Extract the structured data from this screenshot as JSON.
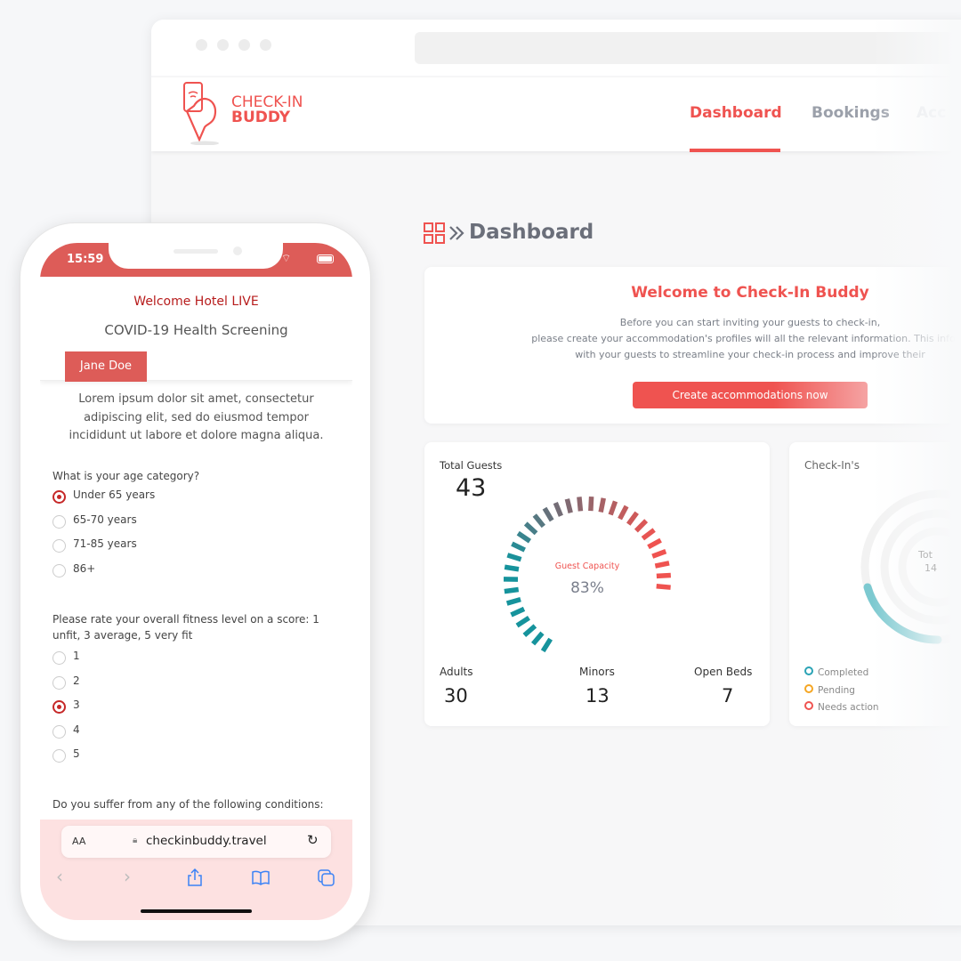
{
  "browser": {
    "nav": {
      "items": [
        {
          "label": "Dashboard",
          "active": true
        },
        {
          "label": "Bookings"
        },
        {
          "label": "Acc"
        }
      ]
    },
    "logo": {
      "line1": "CHECK-IN",
      "line2": "BUDDY"
    },
    "page_title": "Dashboard",
    "welcome": {
      "title": "Welcome to Check-In Buddy",
      "lines": [
        "Before you can start inviting your guests to check-in,",
        "please create your accommodation's profiles will all the relevant information. This inform",
        "with your guests to streamline your check-in process and improve their"
      ],
      "button": "Create accommodations now"
    },
    "stats": {
      "total_label": "Total Guests",
      "total": "43",
      "gauge_label": "Guest Capacity",
      "gauge_value": "83%",
      "capacity_percent": 83,
      "adults_label": "Adults",
      "adults": "30",
      "minors_label": "Minors",
      "minors": "13",
      "beds_label": "Open Beds",
      "beds": "7"
    },
    "checkins": {
      "title": "Check-In's",
      "center_label": "Tot",
      "center_value": "14",
      "legend": [
        {
          "label": "Completed",
          "color": "#2aa3b5"
        },
        {
          "label": "Pending",
          "color": "#f5a623"
        },
        {
          "label": "Needs action",
          "color": "#ef5350"
        }
      ]
    }
  },
  "phone": {
    "time": "15:59",
    "hotel": "Welcome Hotel LIVE",
    "form_title": "COVID-19 Health Screening",
    "guest_tab": "Jane Doe",
    "intro": "Lorem ipsum dolor sit amet, consectetur adipiscing elit, sed do eiusmod tempor incididunt ut labore et dolore magna aliqua.",
    "q1": {
      "text": "What is your age category?",
      "options": [
        "Under 65 years",
        "65-70 years",
        "71-85 years",
        "86+"
      ],
      "selected": 0
    },
    "q2": {
      "text": "Please rate your overall fitness level on a score: 1 unfit, 3 average, 5 very fit",
      "options": [
        "1",
        "2",
        "3",
        "4",
        "5"
      ],
      "selected": 2
    },
    "q3": {
      "text": "Do you suffer from any of the following conditions:"
    },
    "safari": {
      "aa": "AA",
      "url": "checkinbuddy.travel"
    }
  },
  "colors": {
    "accent": "#ef5350",
    "phone_red": "#dd5c58",
    "teal": "#16939c",
    "safari_bg": "#fde1e1"
  }
}
